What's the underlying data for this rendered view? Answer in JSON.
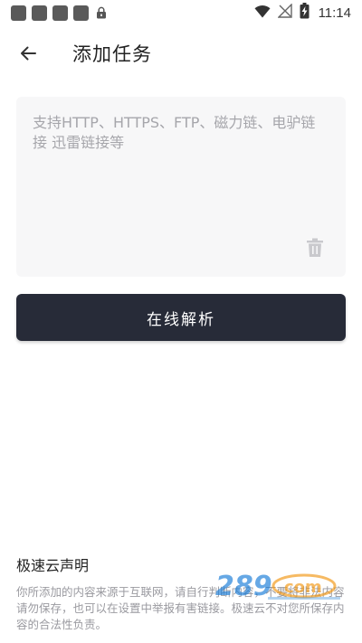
{
  "status_bar": {
    "time": "11:14",
    "notification_count": 4,
    "icons": [
      "notification-square",
      "lock-icon",
      "wifi-icon",
      "no-signal-icon",
      "battery-charging-icon"
    ]
  },
  "app_bar": {
    "title": "添加任务",
    "back_icon": "arrow-left-icon"
  },
  "url_input": {
    "value": "",
    "placeholder": "支持HTTP、HTTPS、FTP、磁力链、电驴链接 迅雷链接等"
  },
  "parse_button": {
    "label": "在线解析"
  },
  "disclaimer": {
    "title": "极速云声明",
    "body": "你所添加的内容来源于互联网，请自行判断内容，不要将非法内容请勿保存，也可以在设置中举报有害链接。极速云不对您所保存内容的合法性负责。"
  },
  "colors": {
    "primary_button": "#272b38",
    "input_background": "#f7f7f8",
    "placeholder": "#a6a6ab",
    "disclaimer_text": "#9a9aa0",
    "watermark_blue": "#1f7fd8",
    "watermark_orange": "#f29a1a"
  }
}
